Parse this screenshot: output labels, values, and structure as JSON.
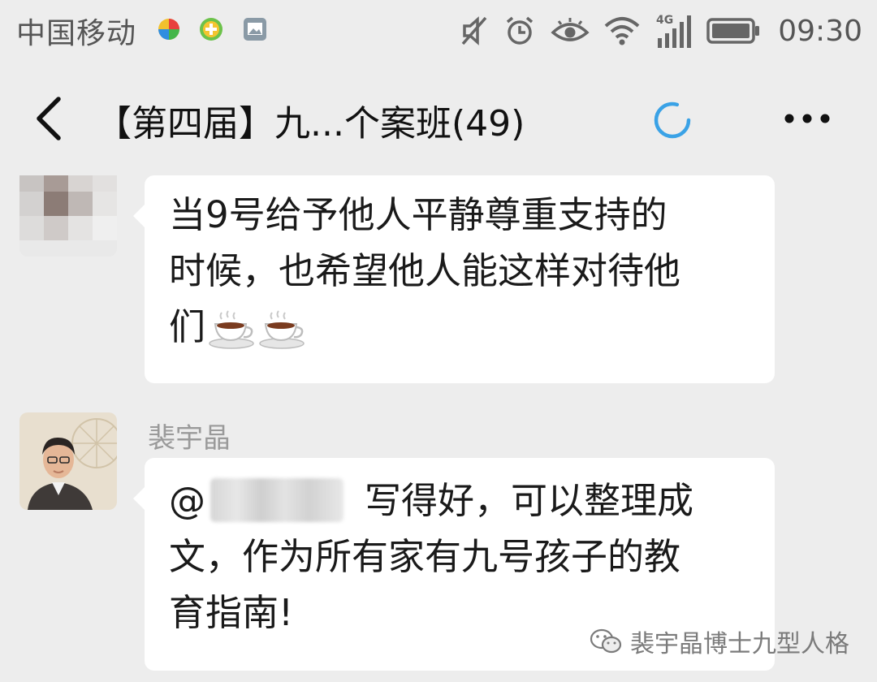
{
  "status_bar": {
    "carrier": "中国移动",
    "network": "4G",
    "time": "09:30"
  },
  "header": {
    "title": "【第四届】九...个案班(49)",
    "back_icon": "chevron-left-icon",
    "more_icon": "more-dots-icon",
    "loading_icon": "loading-spinner-icon"
  },
  "messages": [
    {
      "sender": "",
      "text_lines": [
        "当9号给予他人平静尊重支持的",
        "时候，也希望他人能这样对待他",
        "们"
      ],
      "emoji": [
        "☕",
        "☕"
      ]
    },
    {
      "sender": "裴宇晶",
      "mention_prefix": "@",
      "text_lines": [
        "写得好，可以整理成",
        "文，作为所有家有九号孩子的教",
        "育指南!"
      ]
    }
  ],
  "watermark": {
    "text": "裴宇晶博士九型人格"
  },
  "colors": {
    "background": "#ededed",
    "bubble": "#ffffff",
    "spinner": "#3aa2e6"
  }
}
